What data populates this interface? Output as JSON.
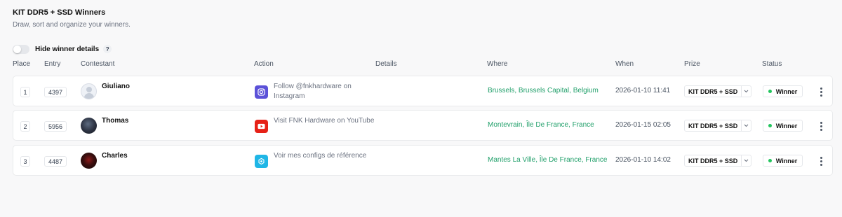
{
  "page": {
    "title": "KIT DDR5 + SSD Winners",
    "subtitle": "Draw, sort and organize your winners."
  },
  "controls": {
    "hide_details_label": "Hide winner details",
    "hide_details_on": false,
    "help_glyph": "?"
  },
  "table": {
    "columns": [
      "Place",
      "Entry",
      "Contestant",
      "Action",
      "Details",
      "Where",
      "When",
      "Prize",
      "Status"
    ],
    "rows": [
      {
        "place": "1",
        "entry": "4397",
        "contestant": "Giuliano",
        "avatar": "default-avatar-icon",
        "action_icon": "instagram-icon",
        "action_color": "#5b51d8",
        "action": "Follow @fnkhardware on Instagram",
        "details": "",
        "where": "Brussels, Brussels Capital, Belgium",
        "when": "2026-01-10 11:41",
        "prize": "KIT DDR5 + SSD",
        "status": "Winner"
      },
      {
        "place": "2",
        "entry": "5956",
        "contestant": "Thomas",
        "avatar": "photo-avatar",
        "action_icon": "youtube-icon",
        "action_color": "#e62117",
        "action": "Visit FNK Hardware on YouTube",
        "details": "",
        "where": "Montevrain, Île De France, France",
        "when": "2026-01-15 02:05",
        "prize": "KIT DDR5 + SSD",
        "status": "Winner"
      },
      {
        "place": "3",
        "entry": "4487",
        "contestant": "Charles",
        "avatar": "photo-avatar",
        "action_icon": "link-icon",
        "action_color": "#1fb6e6",
        "action": "Voir mes configs de référence",
        "details": "",
        "where": "Mantes La Ville, Île De France, France",
        "when": "2026-01-10 14:02",
        "prize": "KIT DDR5 + SSD",
        "status": "Winner"
      }
    ]
  },
  "colors": {
    "location_green": "#22a06b",
    "status_dot": "#22c55e",
    "background": "#f8f8f9"
  }
}
